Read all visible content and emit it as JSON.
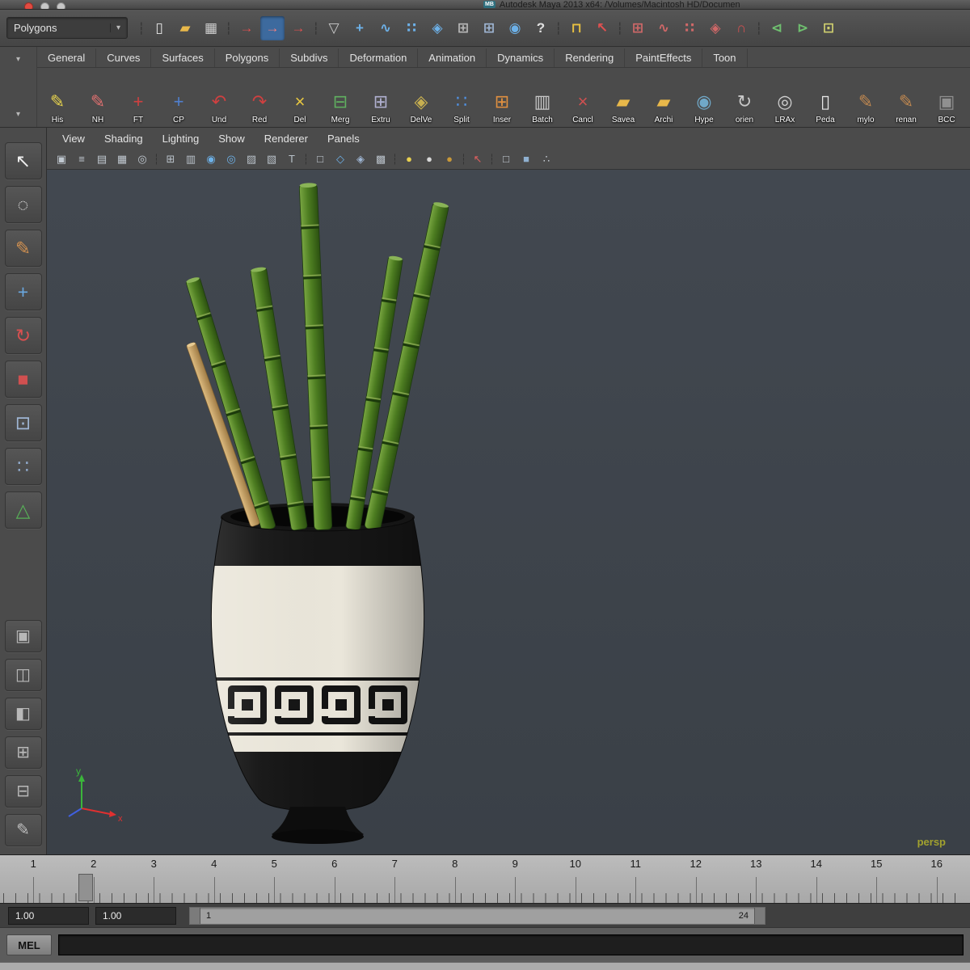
{
  "window": {
    "badge": "MB",
    "title": "Autodesk Maya 2013 x64: /Volumes/Macintosh HD/Documen"
  },
  "status_line": {
    "menu_set": "Polygons",
    "caret": "▾",
    "icons": [
      {
        "name": "toolbar-grip",
        "glyph": "┆",
        "color": "#2f2f2f",
        "cls": "grip"
      },
      {
        "name": "scene-new-icon",
        "glyph": "▯",
        "color": "#e6e6e6"
      },
      {
        "name": "scene-open-icon",
        "glyph": "▰",
        "color": "#e8b84a"
      },
      {
        "name": "scene-save-icon",
        "glyph": "▦",
        "color": "#cfcfcf"
      },
      {
        "name": "toolbar-grip",
        "glyph": "┆",
        "color": "#2f2f2f",
        "cls": "grip"
      },
      {
        "name": "select-hierarchy-icon",
        "glyph": "→",
        "color": "#e05050"
      },
      {
        "name": "select-object-icon",
        "glyph": "→",
        "color": "#f08080",
        "cls": "active"
      },
      {
        "name": "select-component-icon",
        "glyph": "→",
        "color": "#e05050"
      },
      {
        "name": "toolbar-grip",
        "glyph": "┆",
        "color": "#2f2f2f",
        "cls": "grip"
      },
      {
        "name": "highlight-selection-icon",
        "glyph": "▽",
        "color": "#cccccc"
      },
      {
        "name": "snap-to-grids-icon",
        "glyph": "+",
        "color": "#6db1e8"
      },
      {
        "name": "snap-to-curves-icon",
        "glyph": "∿",
        "color": "#6db1e8"
      },
      {
        "name": "snap-to-points-icon",
        "glyph": "∷",
        "color": "#6db1e8"
      },
      {
        "name": "snap-to-planes-icon",
        "glyph": "◈",
        "color": "#6db1e8"
      },
      {
        "name": "grid-display-icon",
        "glyph": "⊞",
        "color": "#b8b8b8"
      },
      {
        "name": "lattice-display-icon",
        "glyph": "⊞",
        "color": "#9fb6d4"
      },
      {
        "name": "make-live-icon",
        "glyph": "◉",
        "color": "#6db1e8"
      },
      {
        "name": "help-icon",
        "glyph": "?",
        "color": "#e0e0e0"
      },
      {
        "name": "toolbar-grip",
        "glyph": "┆",
        "color": "#2f2f2f",
        "cls": "grip"
      },
      {
        "name": "lock-selection-icon",
        "glyph": "⊓",
        "color": "#e8c040"
      },
      {
        "name": "track-selection-icon",
        "glyph": "↖",
        "color": "#e05050"
      },
      {
        "name": "toolbar-grip",
        "glyph": "┆",
        "color": "#2f2f2f",
        "cls": "grip"
      },
      {
        "name": "history-grid-icon",
        "glyph": "⊞",
        "color": "#d06868"
      },
      {
        "name": "history-curve-icon",
        "glyph": "∿",
        "color": "#d06868"
      },
      {
        "name": "history-point-icon",
        "glyph": "∷",
        "color": "#d06868"
      },
      {
        "name": "history-surface-icon",
        "glyph": "◈",
        "color": "#d06868"
      },
      {
        "name": "magnet-icon",
        "glyph": "∩",
        "color": "#d05050"
      },
      {
        "name": "toolbar-grip",
        "glyph": "┆",
        "color": "#2f2f2f",
        "cls": "grip"
      },
      {
        "name": "input-connections-icon",
        "glyph": "⊲",
        "color": "#6fbf6f"
      },
      {
        "name": "output-connections-icon",
        "glyph": "⊳",
        "color": "#6fbf6f"
      },
      {
        "name": "render-settings-icon",
        "glyph": "⊡",
        "color": "#cfcf6f"
      }
    ]
  },
  "shelf": {
    "collapse_arrow": "▾",
    "tabs": [
      {
        "name": "shelf-tab-general",
        "label": "General"
      },
      {
        "name": "shelf-tab-curves",
        "label": "Curves"
      },
      {
        "name": "shelf-tab-surfaces",
        "label": "Surfaces"
      },
      {
        "name": "shelf-tab-polygons",
        "label": "Polygons"
      },
      {
        "name": "shelf-tab-subdivs",
        "label": "Subdivs"
      },
      {
        "name": "shelf-tab-deformation",
        "label": "Deformation"
      },
      {
        "name": "shelf-tab-animation",
        "label": "Animation"
      },
      {
        "name": "shelf-tab-dynamics",
        "label": "Dynamics"
      },
      {
        "name": "shelf-tab-rendering",
        "label": "Rendering"
      },
      {
        "name": "shelf-tab-painteffects",
        "label": "PaintEffects"
      },
      {
        "name": "shelf-tab-toon",
        "label": "Toon"
      }
    ],
    "buttons": [
      {
        "name": "shelf-button-his",
        "label": "His",
        "glyph": "✎",
        "color": "#e8d44d"
      },
      {
        "name": "shelf-button-nh",
        "label": "NH",
        "glyph": "✎",
        "color": "#e07070"
      },
      {
        "name": "shelf-button-ft",
        "label": "FT",
        "glyph": "+",
        "color": "#d04040"
      },
      {
        "name": "shelf-button-cp",
        "label": "CP",
        "glyph": "+",
        "color": "#5080d0"
      },
      {
        "name": "shelf-button-und",
        "label": "Und",
        "glyph": "↶",
        "color": "#d04040"
      },
      {
        "name": "shelf-button-red",
        "label": "Red",
        "glyph": "↷",
        "color": "#d04040"
      },
      {
        "name": "shelf-button-del",
        "label": "Del",
        "glyph": "×",
        "color": "#e8c840"
      },
      {
        "name": "shelf-button-merg",
        "label": "Merg",
        "glyph": "⊟",
        "color": "#60b060"
      },
      {
        "name": "shelf-button-extru",
        "label": "Extru",
        "glyph": "⊞",
        "color": "#b0b0d0"
      },
      {
        "name": "shelf-button-delve",
        "label": "DelVe",
        "glyph": "◈",
        "color": "#c8b050"
      },
      {
        "name": "shelf-button-split",
        "label": "Split",
        "glyph": "∷",
        "color": "#5090e0"
      },
      {
        "name": "shelf-button-inser",
        "label": "Inser",
        "glyph": "⊞",
        "color": "#e09040"
      },
      {
        "name": "shelf-button-batch",
        "label": "Batch",
        "glyph": "▥",
        "color": "#c8c8c8"
      },
      {
        "name": "shelf-button-cancl",
        "label": "Cancl",
        "glyph": "×",
        "color": "#d05050"
      },
      {
        "name": "shelf-button-savea",
        "label": "Savea",
        "glyph": "▰",
        "color": "#e8b84a"
      },
      {
        "name": "shelf-button-archi",
        "label": "Archi",
        "glyph": "▰",
        "color": "#e8b84a"
      },
      {
        "name": "shelf-button-hype",
        "label": "Hype",
        "glyph": "◉",
        "color": "#70a8c8"
      },
      {
        "name": "shelf-button-orien",
        "label": "orien",
        "glyph": "↻",
        "color": "#c8c8c8"
      },
      {
        "name": "shelf-button-lrax",
        "label": "LRAx",
        "glyph": "◎",
        "color": "#d0d0d0"
      },
      {
        "name": "shelf-button-peda",
        "label": "Peda",
        "glyph": "▯",
        "color": "#e8e8e8"
      },
      {
        "name": "shelf-button-mylo",
        "label": "mylo",
        "glyph": "✎",
        "color": "#c08850"
      },
      {
        "name": "shelf-button-renan",
        "label": "renan",
        "glyph": "✎",
        "color": "#c08850"
      },
      {
        "name": "shelf-button-bcc",
        "label": "BCC",
        "glyph": "▣",
        "color": "#909090"
      }
    ]
  },
  "toolbox": {
    "tools": [
      {
        "name": "select-tool",
        "glyph": "↖",
        "color": "#f0f0f0"
      },
      {
        "name": "lasso-select-tool",
        "glyph": "◌",
        "color": "#e0e0e0"
      },
      {
        "name": "paint-select-tool",
        "glyph": "✎",
        "color": "#d09050"
      },
      {
        "name": "move-tool",
        "glyph": "+",
        "color": "#6aa8e0"
      },
      {
        "name": "rotate-tool",
        "glyph": "↻",
        "color": "#d85050"
      },
      {
        "name": "scale-tool",
        "glyph": "■",
        "color": "#d05050"
      },
      {
        "name": "universal-manipulator-tool",
        "glyph": "⊡",
        "color": "#9fb6d4"
      },
      {
        "name": "soft-modification-tool",
        "glyph": "∷",
        "color": "#8fa8c8"
      },
      {
        "name": "show-manipulator-tool",
        "glyph": "△",
        "color": "#58b058"
      }
    ],
    "layouts": [
      {
        "name": "layout-single-pane",
        "glyph": "▣",
        "color": "#b8b8b8"
      },
      {
        "name": "layout-two-pane",
        "glyph": "◫",
        "color": "#b8b8b8"
      },
      {
        "name": "layout-outliner-pane",
        "glyph": "◧",
        "color": "#b8b8b8"
      },
      {
        "name": "layout-four-pane",
        "glyph": "⊞",
        "color": "#b8b8b8"
      },
      {
        "name": "layout-split-pane",
        "glyph": "⊟",
        "color": "#b8b8b8"
      },
      {
        "name": "paint-effects-panel",
        "glyph": "✎",
        "color": "#c0c0c0"
      }
    ]
  },
  "panel": {
    "menus": [
      {
        "name": "panel-menu-view",
        "label": "View"
      },
      {
        "name": "panel-menu-shading",
        "label": "Shading"
      },
      {
        "name": "panel-menu-lighting",
        "label": "Lighting"
      },
      {
        "name": "panel-menu-show",
        "label": "Show"
      },
      {
        "name": "panel-menu-renderer",
        "label": "Renderer"
      },
      {
        "name": "panel-menu-panels",
        "label": "Panels"
      }
    ],
    "icons": [
      {
        "name": "select-camera-icon",
        "glyph": "▣",
        "color": "#c0c8d0"
      },
      {
        "name": "camera-attributes-icon",
        "glyph": "≡",
        "color": "#c0c8d0"
      },
      {
        "name": "bookmarks-icon",
        "glyph": "▤",
        "color": "#c0c8d0"
      },
      {
        "name": "image-plane-icon",
        "glyph": "▦",
        "color": "#c0c8d0"
      },
      {
        "name": "two-d-pan-zoom-icon",
        "glyph": "◎",
        "color": "#c0c8d0"
      },
      {
        "name": "panel-grip",
        "glyph": "┆",
        "color": "#333333",
        "cls": "grip"
      },
      {
        "name": "grid-toggle-icon",
        "glyph": "⊞",
        "color": "#b8c0c8"
      },
      {
        "name": "film-gate-icon",
        "glyph": "▥",
        "color": "#b8c0c8"
      },
      {
        "name": "resolution-gate-icon",
        "glyph": "◉",
        "color": "#6db1e8"
      },
      {
        "name": "gate-mask-icon",
        "glyph": "◎",
        "color": "#6db1e8"
      },
      {
        "name": "field-chart-icon",
        "glyph": "▨",
        "color": "#b8c0c8"
      },
      {
        "name": "safe-action-icon",
        "glyph": "▧",
        "color": "#b8c0c8"
      },
      {
        "name": "safe-title-icon",
        "glyph": "T",
        "color": "#b8c0c8"
      },
      {
        "name": "panel-grip",
        "glyph": "┆",
        "color": "#333333",
        "cls": "grip"
      },
      {
        "name": "isolate-select-icon",
        "glyph": "□",
        "color": "#c8d0d8"
      },
      {
        "name": "xray-icon",
        "glyph": "◇",
        "color": "#6db1e8"
      },
      {
        "name": "wireframe-on-shaded-icon",
        "glyph": "◈",
        "color": "#9fb6d4"
      },
      {
        "name": "textured-mode-icon",
        "glyph": "▩",
        "color": "#b8c0c8"
      },
      {
        "name": "panel-grip",
        "glyph": "┆",
        "color": "#333333",
        "cls": "grip"
      },
      {
        "name": "default-light-icon",
        "glyph": "●",
        "color": "#e8d050"
      },
      {
        "name": "flat-light-icon",
        "glyph": "●",
        "color": "#d8d8d8"
      },
      {
        "name": "all-lights-icon",
        "glyph": "●",
        "color": "#c89838"
      },
      {
        "name": "panel-grip",
        "glyph": "┆",
        "color": "#333333",
        "cls": "grip"
      },
      {
        "name": "select-cursor-icon",
        "glyph": "↖",
        "color": "#e06060"
      },
      {
        "name": "panel-grip",
        "glyph": "┆",
        "color": "#333333",
        "cls": "grip"
      },
      {
        "name": "wireframe-cube-icon",
        "glyph": "□",
        "color": "#c8d0d8"
      },
      {
        "name": "shaded-cube-icon",
        "glyph": "■",
        "color": "#8fb0d0"
      },
      {
        "name": "share-view-icon",
        "glyph": "∴",
        "color": "#c8d0d8"
      }
    ],
    "camera_label": "persp",
    "axis_labels": {
      "x": "x",
      "y": "y"
    }
  },
  "timeline": {
    "frames": [
      "1",
      "2",
      "3",
      "4",
      "5",
      "6",
      "7",
      "8",
      "9",
      "10",
      "11",
      "12",
      "13",
      "14",
      "15",
      "16"
    ]
  },
  "range_slider": {
    "anim_start": "1.00",
    "playback_start": "1.00",
    "range_start": "1",
    "range_end": "24"
  },
  "command_line": {
    "label": "MEL"
  }
}
